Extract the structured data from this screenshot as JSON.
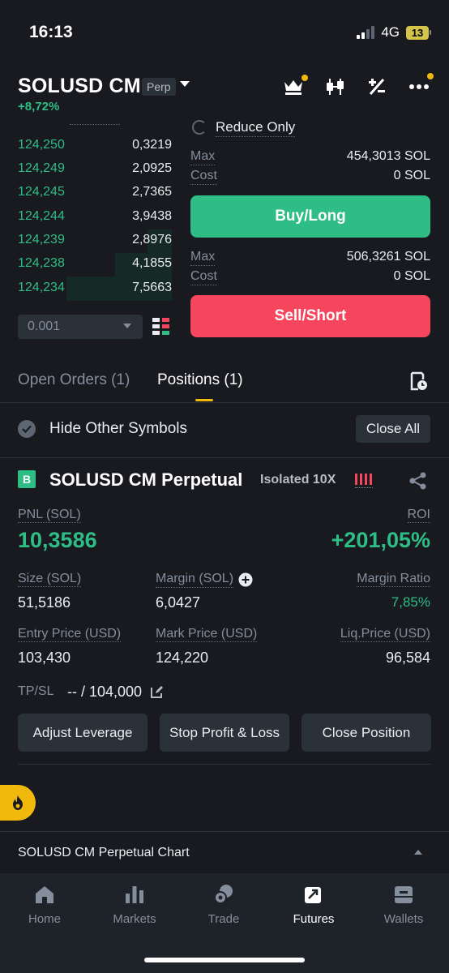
{
  "status_bar": {
    "time": "16:13",
    "network": "4G",
    "battery": "13"
  },
  "header": {
    "symbol": "SOLUSD CM",
    "badge": "Perp",
    "change": "+8,72%",
    "icons": [
      "crown-icon",
      "candlestick-icon",
      "calculator-icon",
      "more-icon"
    ]
  },
  "order_book": {
    "rows": [
      {
        "price": "124,250",
        "qty": "0,3219"
      },
      {
        "price": "124,249",
        "qty": "2,0925"
      },
      {
        "price": "124,245",
        "qty": "2,7365"
      },
      {
        "price": "124,244",
        "qty": "3,9438"
      },
      {
        "price": "124,239",
        "qty": "2,8976"
      },
      {
        "price": "124,238",
        "qty": "4,1855"
      },
      {
        "price": "124,234",
        "qty": "7,5663"
      }
    ],
    "step": "0.001"
  },
  "trade_panel": {
    "reduce_only": "Reduce Only",
    "buy": {
      "max_label": "Max",
      "max_value": "454,3013 SOL",
      "cost_label": "Cost",
      "cost_value": "0 SOL",
      "button": "Buy/Long"
    },
    "sell": {
      "max_label": "Max",
      "max_value": "506,3261 SOL",
      "cost_label": "Cost",
      "cost_value": "0 SOL",
      "button": "Sell/Short"
    }
  },
  "tabs": {
    "open_orders": "Open Orders (1)",
    "positions": "Positions (1)"
  },
  "filter": {
    "hide_other": "Hide Other Symbols",
    "close_all": "Close All"
  },
  "position": {
    "side_badge": "B",
    "title": "SOLUSD CM Perpetual",
    "margin_mode": "Isolated 10X",
    "pnl_label": "PNL (SOL)",
    "pnl": "10,3586",
    "roi_label": "ROI",
    "roi": "+201,05%",
    "size_label": "Size (SOL)",
    "size": "51,5186",
    "margin_label": "Margin (SOL)",
    "margin": "6,0427",
    "margin_ratio_label": "Margin Ratio",
    "margin_ratio": "7,85%",
    "entry_label": "Entry Price (USD)",
    "entry": "103,430",
    "mark_label": "Mark Price (USD)",
    "mark": "124,220",
    "liq_label": "Liq.Price (USD)",
    "liq": "96,584",
    "tpsl_label": "TP/SL",
    "tpsl": "-- / 104,000",
    "buttons": {
      "adjust": "Adjust Leverage",
      "stop": "Stop Profit & Loss",
      "close": "Close Position"
    }
  },
  "chart_bar": {
    "label": "SOLUSD CM Perpetual  Chart"
  },
  "nav": [
    {
      "label": "Home",
      "icon": "home-icon"
    },
    {
      "label": "Markets",
      "icon": "markets-icon"
    },
    {
      "label": "Trade",
      "icon": "trade-icon"
    },
    {
      "label": "Futures",
      "icon": "futures-icon",
      "active": true
    },
    {
      "label": "Wallets",
      "icon": "wallet-icon"
    }
  ],
  "colors": {
    "bg": "#181a20",
    "green": "#2ebd85",
    "red": "#f6465d",
    "accent": "#f0b90b",
    "panel": "#2b3139"
  }
}
